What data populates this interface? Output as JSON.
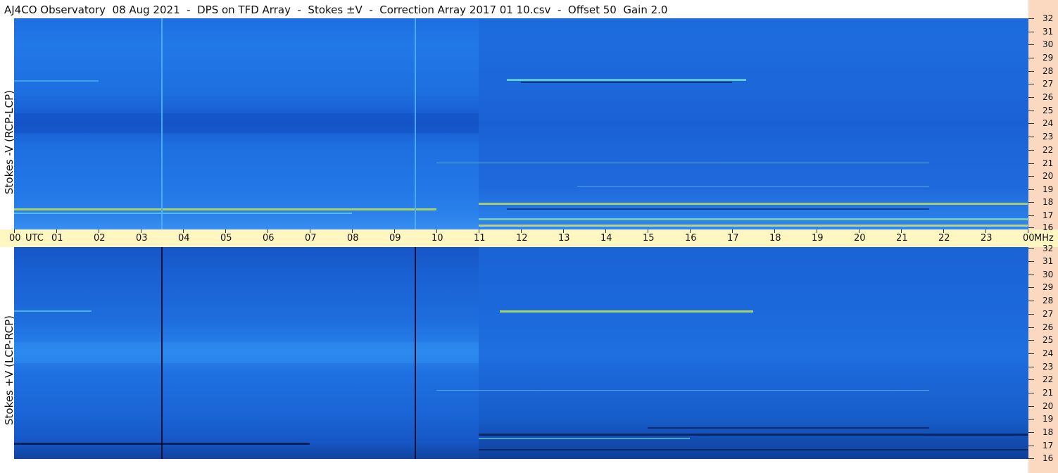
{
  "title": "AJ4CO Observatory  08 Aug 2021  -  DPS on TFD Array  -  Stokes ±V  -  Correction Array 2017 01 10.csv  -  Offset 50  Gain 2.0",
  "panels": {
    "top": {
      "ylabel": "Stokes -V (RCP-LCP)"
    },
    "bottom": {
      "ylabel": "Stokes +V (LCP-RCP)"
    }
  },
  "time_axis": {
    "labels": [
      "00",
      "01",
      "02",
      "03",
      "04",
      "05",
      "06",
      "07",
      "08",
      "09",
      "10",
      "11",
      "12",
      "13",
      "14",
      "15",
      "16",
      "17",
      "18",
      "19",
      "20",
      "21",
      "22",
      "23",
      "00"
    ],
    "utc_label": "UTC",
    "freq_unit": "MHz"
  },
  "freq_axis": {
    "labels": [
      "32",
      "31",
      "30",
      "29",
      "28",
      "27",
      "26",
      "25",
      "24",
      "23",
      "22",
      "21",
      "20",
      "19",
      "18",
      "17",
      "16"
    ]
  },
  "colors": {
    "spectrogram_base": "#1a72e0",
    "axis_right_bg": "#fbd9c0",
    "axis_time_bg": "#fff6c2"
  }
}
